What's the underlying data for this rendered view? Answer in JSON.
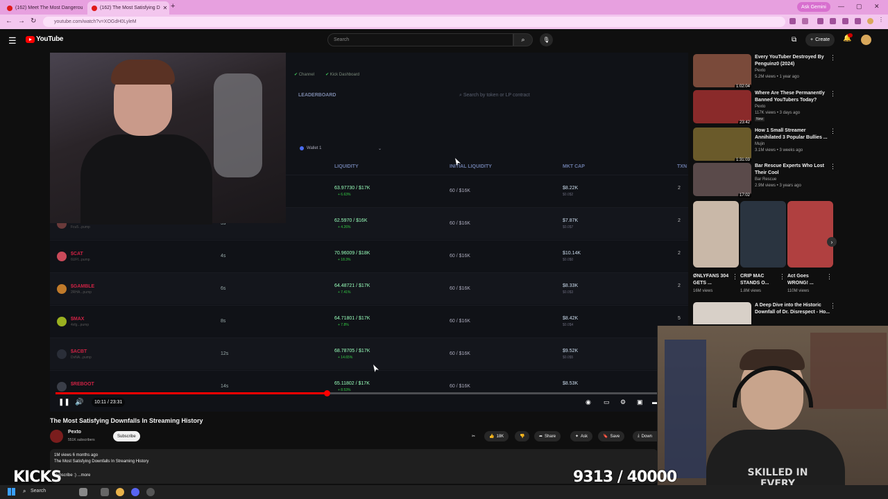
{
  "browser": {
    "tabs": [
      {
        "label": "(162) Meet The Most Dangerou"
      },
      {
        "label": "(162) The Most Satisfying D"
      }
    ],
    "gemini_label": "Ask Gemini",
    "url": "youtube.com/watch?v=XOGdH0LyleM"
  },
  "youtube": {
    "logo_text": "YouTube",
    "search_placeholder": "Search",
    "create_label": "Create",
    "notification_count": "9+"
  },
  "player": {
    "dashboard": {
      "nav": [
        "Channel",
        "Kick Dashboard"
      ],
      "tab": "LEADERBOARD",
      "search_placeholder": "Search by token or LP contract",
      "wallet": "Wallet 1",
      "columns": [
        "LIQUIDITY",
        "INITIAL LIQUIDITY",
        "MKT CAP",
        "TXN"
      ],
      "rows": [
        {
          "token": "",
          "sub": "",
          "age": "",
          "liquidity": "63.97730 / $17K",
          "change": "+ 6.63%",
          "initial": "60 / $16K",
          "mcap": "$8.22K",
          "mcap_sub": "$0.0$2",
          "txn": "2"
        },
        {
          "token": "",
          "sub": "Fcu5...pump",
          "age": "3s",
          "liquidity": "62.5970 / $16K",
          "change": "+ 4.26%",
          "initial": "60 / $16K",
          "mcap": "$7.87K",
          "mcap_sub": "$0.0$7",
          "txn": "2"
        },
        {
          "token": "$CAT",
          "sub": "6UFf...pump",
          "age": "4s",
          "liquidity": "70.96009 / $18K",
          "change": "+ 18.3%",
          "initial": "60 / $16K",
          "mcap": "$10.14K",
          "mcap_sub": "$0.0$0",
          "txn": "2"
        },
        {
          "token": "$GAMBLE",
          "sub": "2RHA...pump",
          "age": "6s",
          "liquidity": "64.48721 / $17K",
          "change": "+ 7.41%",
          "initial": "60 / $16K",
          "mcap": "$8.33K",
          "mcap_sub": "$0.0$3",
          "txn": "2"
        },
        {
          "token": "$MAX",
          "sub": "4xfg...pump",
          "age": "8s",
          "liquidity": "64.71801 / $17K",
          "change": "+ 7.8%",
          "initial": "60 / $16K",
          "mcap": "$8.42K",
          "mcap_sub": "$0.0$4",
          "txn": "5"
        },
        {
          "token": "$ACBT",
          "sub": "DvNA...pump",
          "age": "12s",
          "liquidity": "68.78705 / $17K",
          "change": "+ 14.65%",
          "initial": "60 / $16K",
          "mcap": "$9.52K",
          "mcap_sub": "$0.0$5",
          "txn": "2"
        },
        {
          "token": "$REBOOT",
          "sub": "",
          "age": "14s",
          "liquidity": "65.11802 / $17K",
          "change": "+ 8.53%",
          "initial": "60 / $16K",
          "mcap": "$8.53K",
          "mcap_sub": "",
          "txn": "2"
        }
      ]
    },
    "time": "10:11 / 23:31",
    "progress": 0.433
  },
  "video": {
    "title": "The Most Satisfying Downfalls In Streaming History",
    "channel": "Pexto",
    "subscribers": "551K subscribers",
    "subscribe_label": "Subscribe",
    "likes": "18K",
    "share_label": "Share",
    "ask_label": "Ask",
    "save_label": "Save",
    "download_label": "Down",
    "description_meta": "1M views  6 months ago",
    "description_line": "The Most Satisfying Downfalls In Streaming History",
    "description_tail": "Subscribe :) ...more"
  },
  "recommendations": [
    {
      "title": "Every YouTuber Destroyed By Penguinz0 (2024)",
      "channel": "Pexto",
      "meta": "5.2M views • 1 year ago",
      "duration": "1:02:04",
      "badge": ""
    },
    {
      "title": "Where Are These Permanently Banned YouTubers Today?",
      "channel": "Pexto",
      "meta": "117K views • 3 days ago",
      "duration": "23:42",
      "badge": "New"
    },
    {
      "title": "How 1 Small Streamer Annihilated 3 Popular Bullies ...",
      "channel": "Mujin",
      "meta": "3.1M views • 3 weeks ago",
      "duration": "1:31:03",
      "badge": ""
    },
    {
      "title": "Bar Rescue Experts Who Lost Their Cool",
      "channel": "Bar Rescue",
      "meta": "2.9M views • 3 years ago",
      "duration": "17:02",
      "badge": ""
    },
    {
      "title": "A Deep Dive into the Historic Downfall of Dr. Disrespect - Ho...",
      "channel": "",
      "meta": "",
      "duration": "",
      "badge": ""
    }
  ],
  "shorts": [
    {
      "title": "ØNLYFANS 304 GETS ...",
      "views": "16M views"
    },
    {
      "title": "CRIP MAC STANDS O...",
      "views": "1.8M views"
    },
    {
      "title": "Act Goes WRONG! ...",
      "views": "110M views"
    }
  ],
  "overlay": {
    "kicks_label": "KICKS",
    "counter": "9313 / 40000",
    "shirt_text": "SKILLED IN EVERY"
  },
  "taskbar": {
    "search_label": "Search"
  }
}
